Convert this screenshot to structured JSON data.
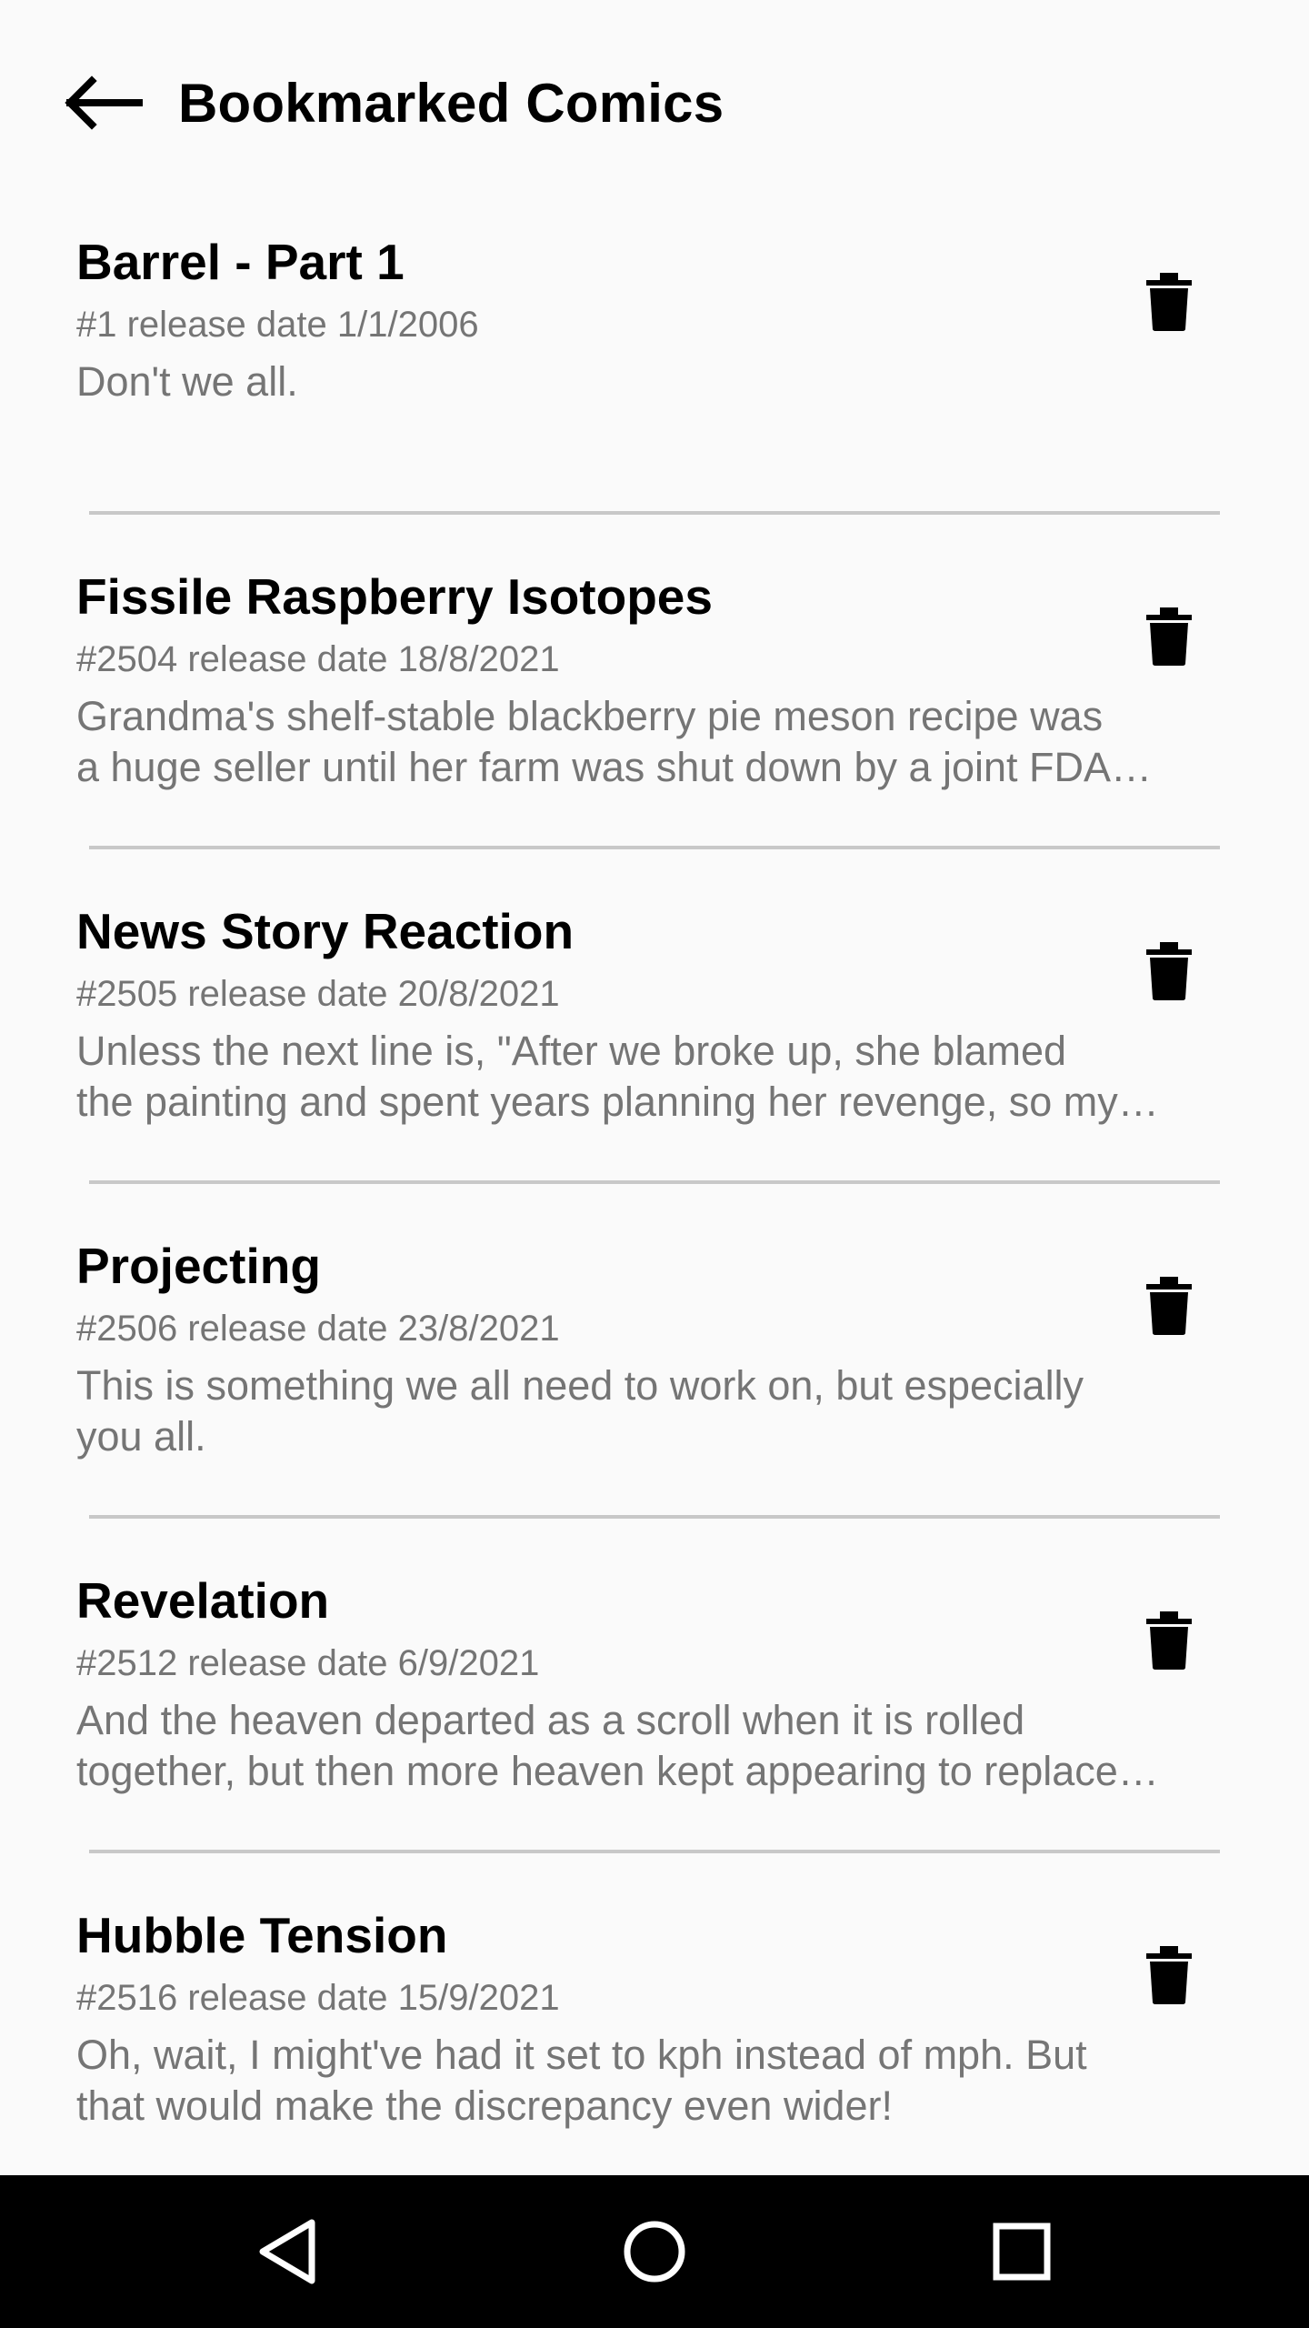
{
  "header": {
    "title": "Bookmarked Comics",
    "back_icon": "arrow-left-icon"
  },
  "comics": [
    {
      "title": "Barrel - Part 1",
      "meta": "#1 release date 1/1/2006",
      "description_lines": [
        "Don't we all."
      ],
      "delete_icon": "trash-icon"
    },
    {
      "title": "Fissile Raspberry Isotopes",
      "meta": "#2504 release date 18/8/2021",
      "description_lines": [
        "Grandma's shelf-stable blackberry pie meson recipe was",
        "a huge seller until her farm was shut down by a joint FDA…"
      ],
      "delete_icon": "trash-icon"
    },
    {
      "title": "News Story Reaction",
      "meta": "#2505 release date 20/8/2021",
      "description_lines": [
        "Unless the next line is, \"After we broke up, she blamed",
        "the painting and spent years planning her revenge, so my…"
      ],
      "delete_icon": "trash-icon"
    },
    {
      "title": "Projecting",
      "meta": "#2506 release date 23/8/2021",
      "description_lines": [
        "This is something we all need to work on, but especially",
        "you all."
      ],
      "delete_icon": "trash-icon"
    },
    {
      "title": "Revelation",
      "meta": "#2512 release date 6/9/2021",
      "description_lines": [
        "And the heaven departed as a scroll when it is rolled",
        "together, but then more heaven kept appearing to replace…"
      ],
      "delete_icon": "trash-icon"
    },
    {
      "title": "Hubble Tension",
      "meta": "#2516 release date 15/9/2021",
      "description_lines": [
        "Oh, wait, I might've had it set to kph instead of mph. But",
        "that would make the discrepancy even wider!"
      ],
      "delete_icon": "trash-icon"
    }
  ],
  "nav_bar": {
    "back_icon": "nav-back-triangle-icon",
    "home_icon": "nav-home-circle-icon",
    "recents_icon": "nav-recents-square-icon"
  },
  "colors": {
    "background": "#fafafa",
    "secondary_text": "#757575",
    "divider": "#c8c8c8",
    "nav_bar": "#000000"
  }
}
